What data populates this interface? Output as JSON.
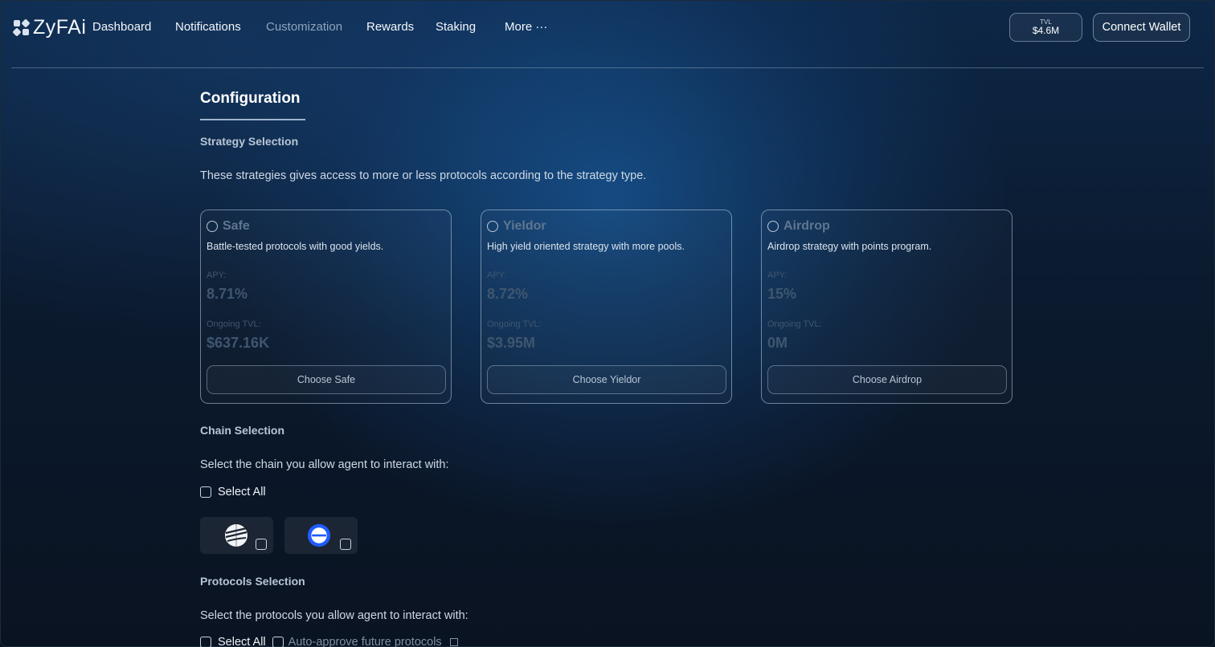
{
  "app": {
    "logo_text": "ZyFAi"
  },
  "nav": {
    "items": [
      {
        "label": "Dashboard"
      },
      {
        "label": "Notifications"
      },
      {
        "label": "Customization"
      },
      {
        "label": "Rewards"
      },
      {
        "label": "Staking"
      },
      {
        "label": "More ···"
      }
    ],
    "active": "Customization"
  },
  "header": {
    "tvl_label": "TVL",
    "tvl_value": "$4.6M",
    "connect_label": "Connect Wallet"
  },
  "page": {
    "title": "Configuration"
  },
  "strategy": {
    "title": "Strategy Selection",
    "description": "These strategies gives access to more or less protocols according to the strategy type.",
    "cards": [
      {
        "name": "Safe",
        "description": "Battle-tested protocols with good yields.",
        "apy_label": "APY:",
        "apy": "8.71%",
        "tvl_label": "Ongoing TVL:",
        "tvl": "$637.16K",
        "button": "Choose Safe"
      },
      {
        "name": "Yieldor",
        "description": "High yield oriented strategy with more pools.",
        "apy_label": "APY:",
        "apy": "8.72%",
        "tvl_label": "Ongoing TVL:",
        "tvl": "$3.95M",
        "button": "Choose Yieldor"
      },
      {
        "name": "Airdrop",
        "description": "Airdrop strategy with points program.",
        "apy_label": "APY:",
        "apy": "15%",
        "tvl_label": "Ongoing TVL:",
        "tvl": "0M",
        "button": "Choose Airdrop"
      }
    ]
  },
  "chain": {
    "title": "Chain Selection",
    "description": "Select the chain you allow agent to interact with:",
    "select_all": "Select All",
    "chains": [
      {
        "icon": "sonic-chain-icon"
      },
      {
        "icon": "base-chain-icon",
        "color": "#1f5cff"
      }
    ]
  },
  "protocols": {
    "title": "Protocols Selection",
    "description": "Select the protocols you allow agent to interact with:",
    "select_all": "Select All",
    "auto_approve": "Auto-approve future protocols"
  },
  "colors": {
    "accent": "#9fb4cc",
    "base_blue": "#1f5cff",
    "background": "#0b1a2e"
  }
}
